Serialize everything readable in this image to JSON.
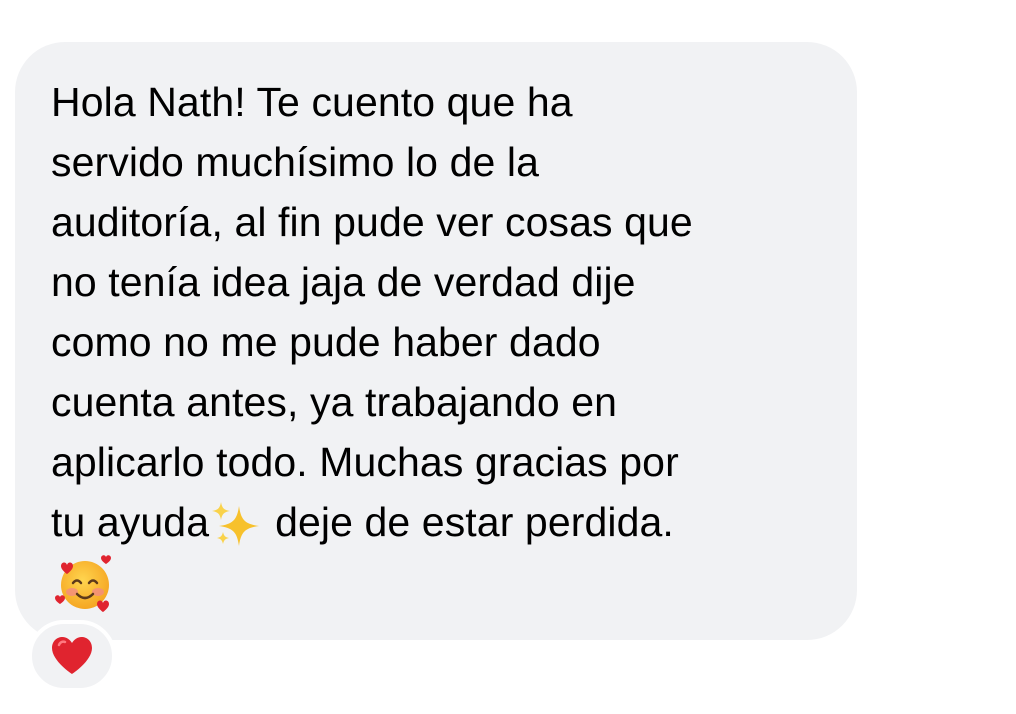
{
  "message": {
    "lines": [
      "Hola Nath! Te cuento que ha",
      "servido muchísimo lo de la",
      "auditoría, al fin pude ver cosas que",
      "no tenía idea jaja de verdad dije",
      "como no me pude haber dado",
      "cuenta antes, ya trabajando en",
      "aplicarlo todo. Muchas gracias por"
    ],
    "last_line_before_emoji": "tu ayuda",
    "last_line_after_emoji": "deje de estar perdida.",
    "inline_emoji": "sparkles-icon",
    "trailing_emoji": "smiling-face-with-hearts-icon"
  },
  "reaction": {
    "emoji": "red-heart-icon"
  },
  "colors": {
    "background": "#ffffff",
    "bubble": "#f1f2f4",
    "text": "#000000",
    "heart": "#e0242f",
    "sparkle": "#f7c12c"
  }
}
